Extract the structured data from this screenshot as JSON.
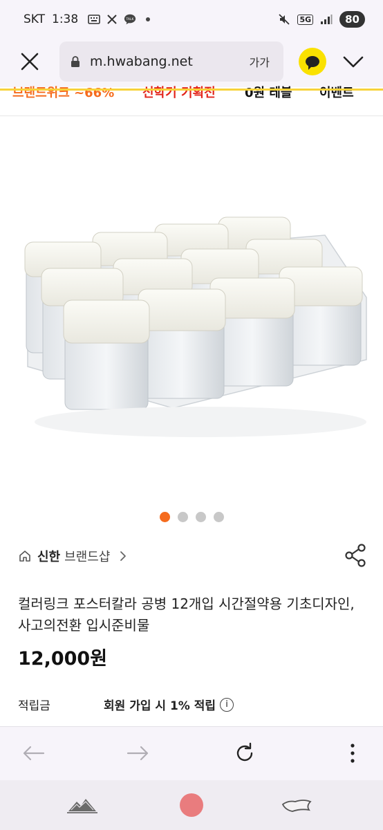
{
  "status_bar": {
    "carrier": "SKT",
    "time": "1:38",
    "network": "5G",
    "battery": "80",
    "notification_icons": [
      "keyboard-icon",
      "x-icon",
      "kakaotalk-icon",
      "dot-icon"
    ]
  },
  "url_bar": {
    "url": "m.hwabang.net",
    "text_size_label": "가가"
  },
  "category_nav": {
    "items": [
      {
        "label": "브랜드위크 ~66%",
        "color": "#f56b1d"
      },
      {
        "label": "신학기 기획전",
        "color": "#e2231a"
      },
      {
        "label": "0원 테블",
        "color": "#111111"
      },
      {
        "label": "이벤트",
        "color": "#111111"
      }
    ]
  },
  "carousel": {
    "total": 4,
    "active": 0,
    "active_color": "#f56b1d"
  },
  "brand": {
    "name": "신한",
    "suffix": "브랜드샵"
  },
  "product": {
    "title": "컬러링크 포스터칼라 공병 12개입 시간절약용 기초디자인, 사고의전환 입시준비물",
    "price": "12,000원"
  },
  "points": {
    "label": "적립금",
    "value": "회원 가입 시 1% 적립",
    "info_symbol": "i"
  }
}
